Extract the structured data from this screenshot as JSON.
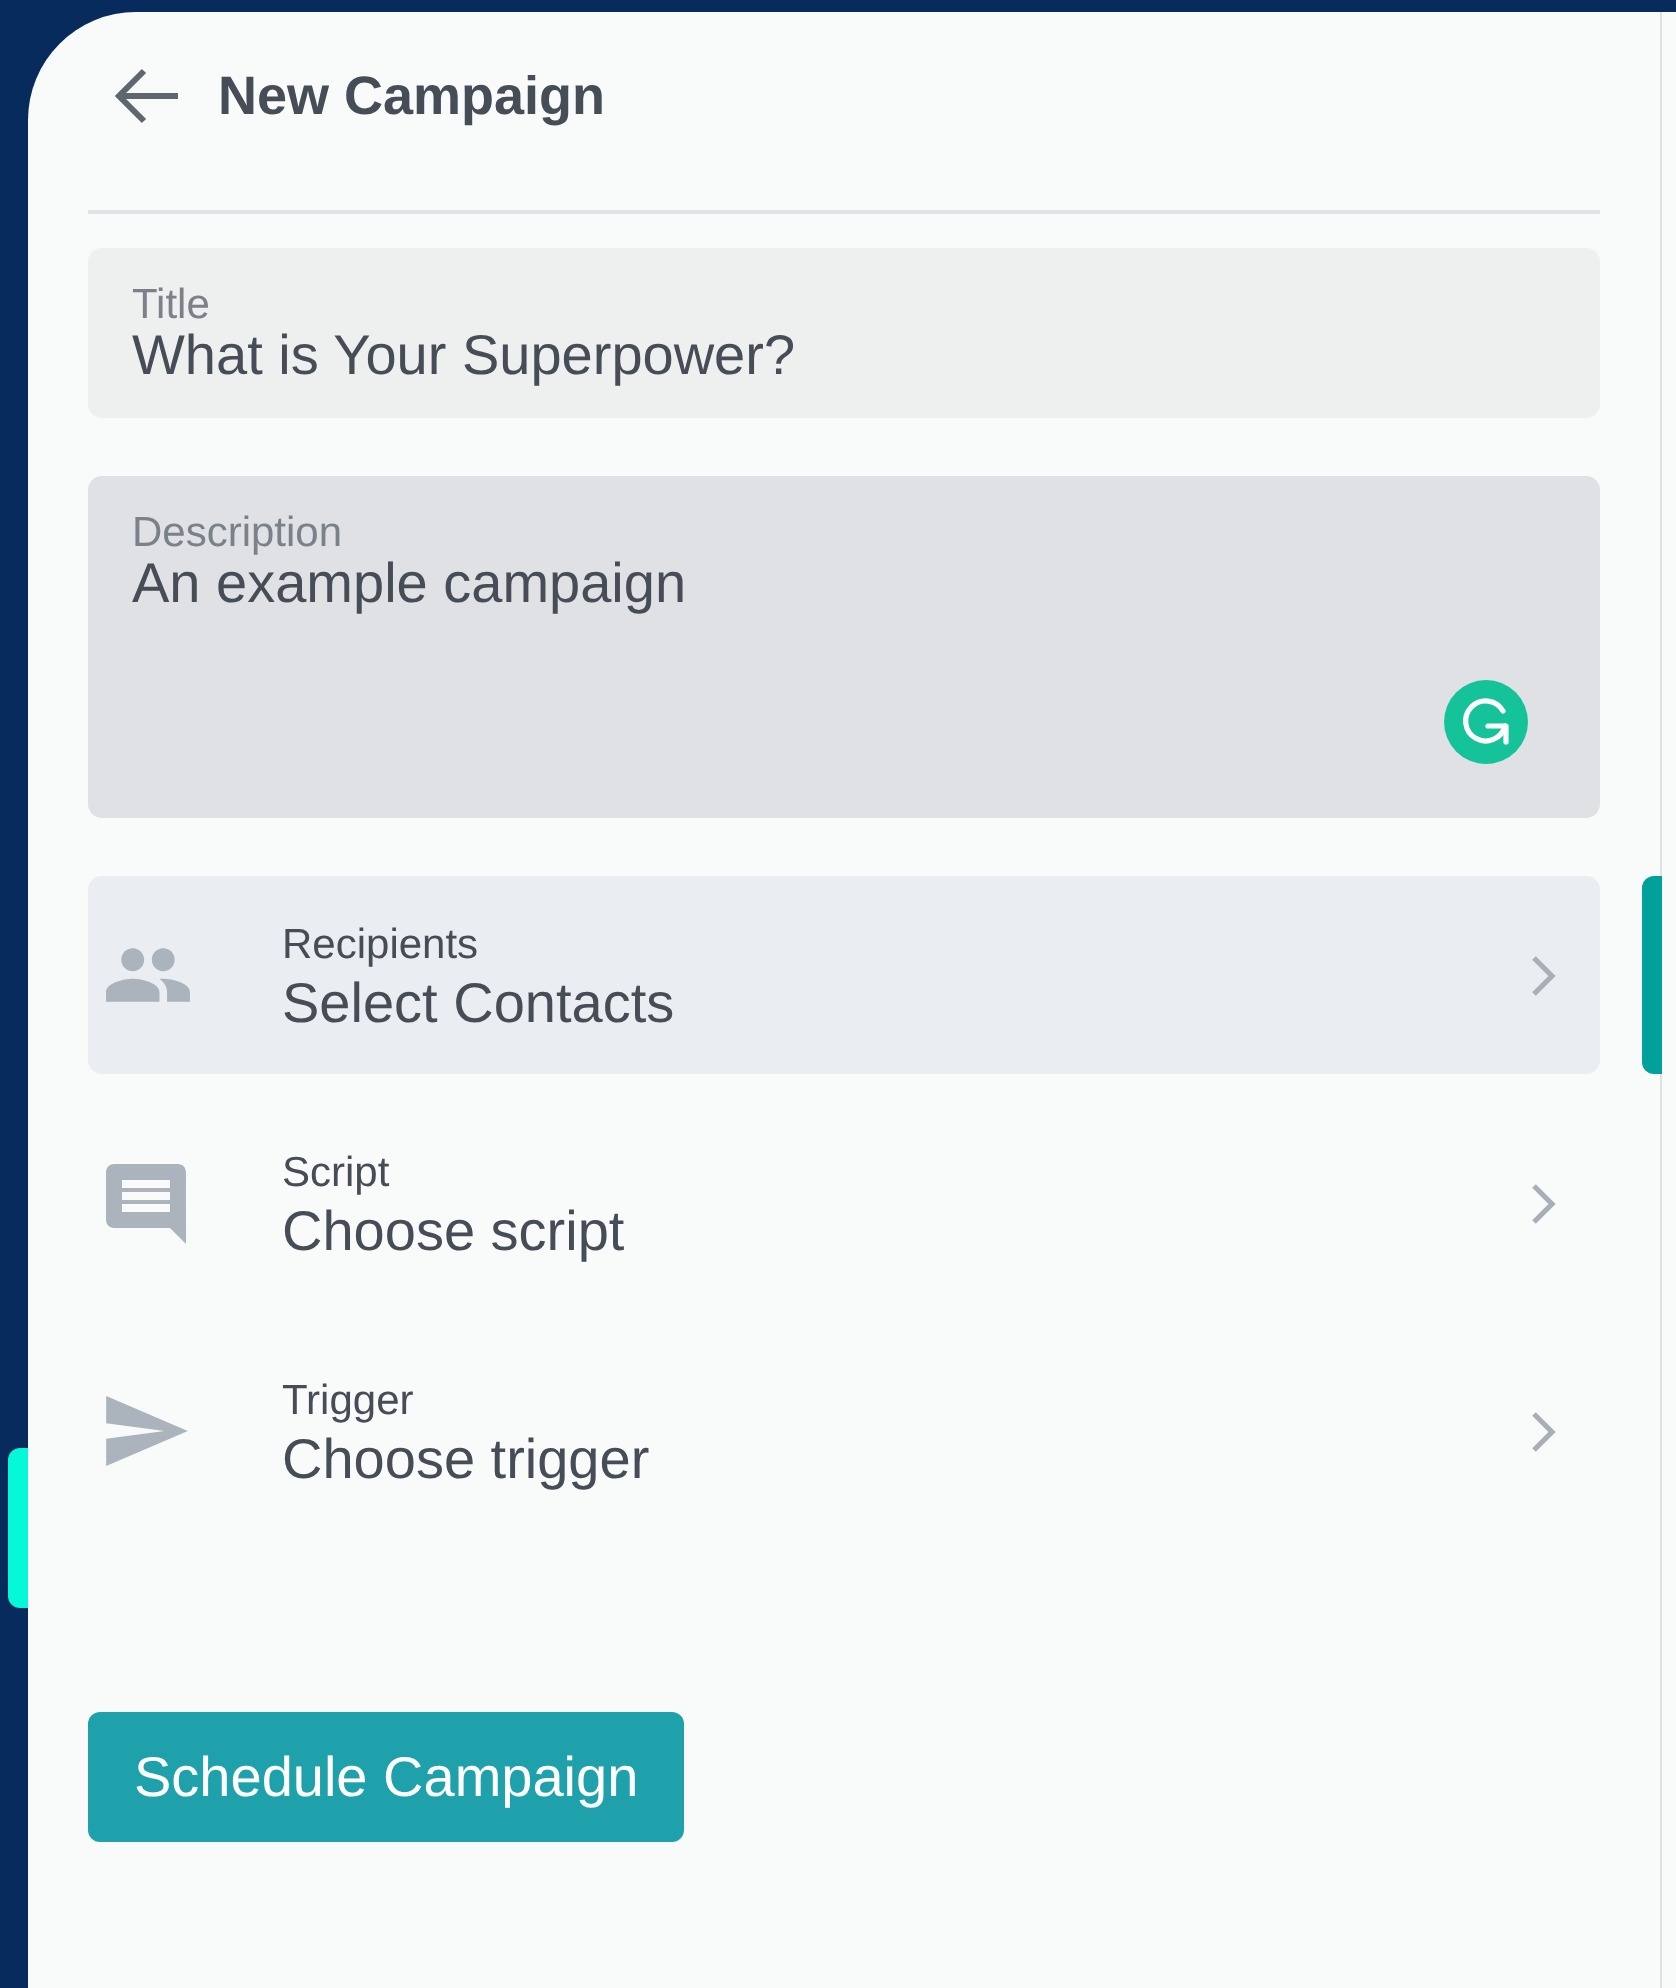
{
  "header": {
    "title": "New Campaign"
  },
  "fields": [
    {
      "kind": "text",
      "label": "Title",
      "value": "What is Your Superpower?",
      "focused": false
    },
    {
      "kind": "textarea",
      "label": "Description",
      "value": "An example campaign",
      "focused": true
    }
  ],
  "rows": [
    {
      "kind": "recipients",
      "label": "Recipients",
      "value": "Select Contacts",
      "selected": true
    },
    {
      "kind": "script",
      "label": "Script",
      "value": "Choose script",
      "selected": false
    },
    {
      "kind": "trigger",
      "label": "Trigger",
      "value": "Choose trigger",
      "selected": false
    }
  ],
  "button": {
    "label": "Schedule Campaign"
  }
}
